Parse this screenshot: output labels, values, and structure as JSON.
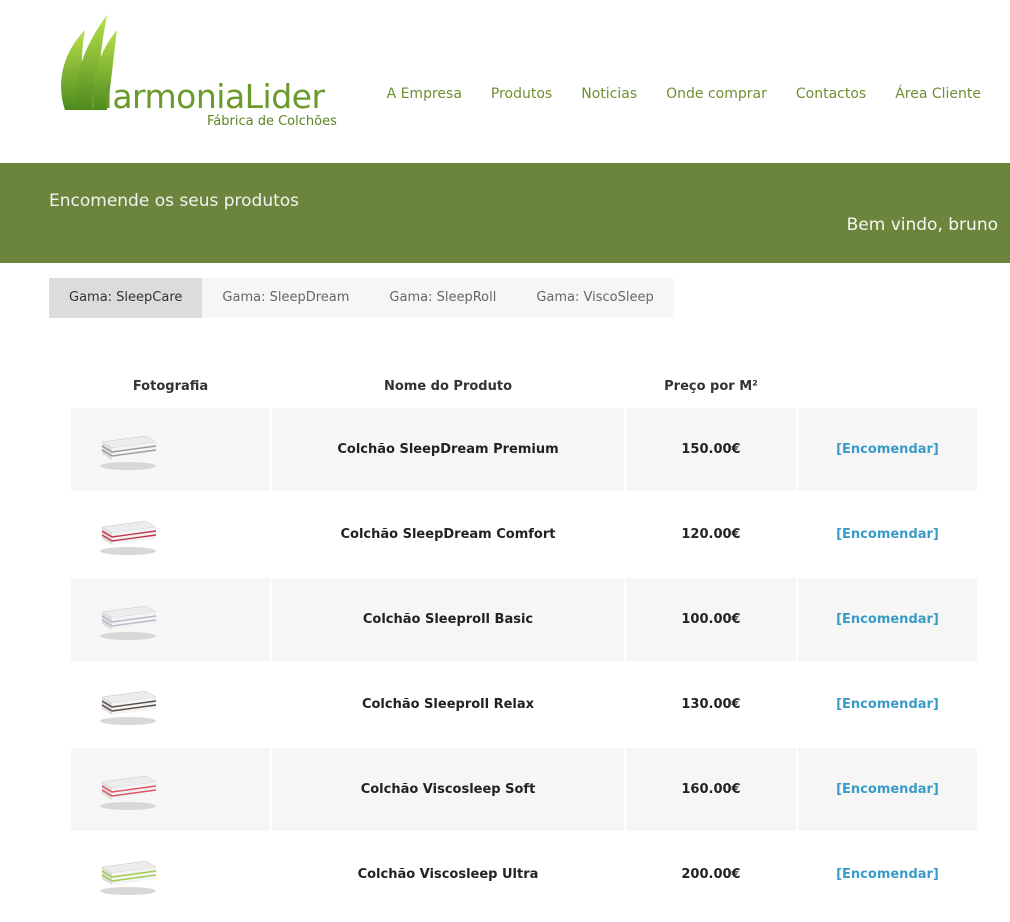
{
  "brand": {
    "name_first": "Harmonia",
    "name_second": "Lider",
    "tagline": "Fábrica de Colchões",
    "primary_color": "#6b863c",
    "leaf_color": "#8cc63f"
  },
  "nav": {
    "items": [
      "A Empresa",
      "Produtos",
      "Noticias",
      "Onde comprar",
      "Contactos",
      "Área Cliente"
    ]
  },
  "banner": {
    "title": "Encomende os seus produtos",
    "welcome": "Bem vindo, bruno"
  },
  "tabs": [
    {
      "label": "Gama: SleepCare",
      "active": true
    },
    {
      "label": "Gama: SleepDream",
      "active": false
    },
    {
      "label": "Gama: SleepRoll",
      "active": false
    },
    {
      "label": "Gama: ViscoSleep",
      "active": false
    }
  ],
  "table": {
    "headers": {
      "photo": "Fotografia",
      "name": "Nome do Produto",
      "price": "Preço por M²"
    },
    "order_label": "[Encomendar]",
    "link_color": "#3a9bc6",
    "rows": [
      {
        "name": "Colchão SleepDream Premium",
        "price": "150.00€",
        "accent": "#9a9a9a"
      },
      {
        "name": "Colchão SleepDream Comfort",
        "price": "120.00€",
        "accent": "#c0394b"
      },
      {
        "name": "Colchão Sleeproll Basic",
        "price": "100.00€",
        "accent": "#b8b8c8"
      },
      {
        "name": "Colchão Sleeproll Relax",
        "price": "130.00€",
        "accent": "#5a4a42"
      },
      {
        "name": "Colchão Viscosleep Soft",
        "price": "160.00€",
        "accent": "#e05060"
      },
      {
        "name": "Colchão Viscosleep Ultra",
        "price": "200.00€",
        "accent": "#9ccc4c"
      }
    ]
  }
}
